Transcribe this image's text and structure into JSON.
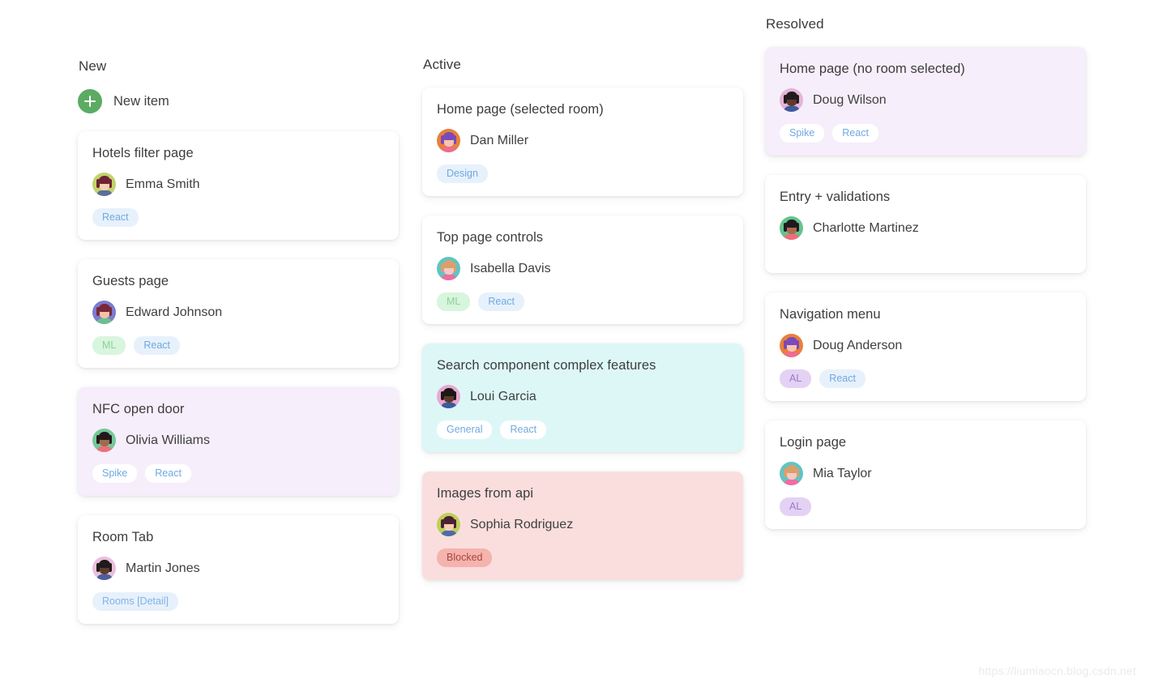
{
  "board": {
    "watermark": "https://liumiaocn.blog.csdn.net",
    "columns": [
      {
        "id": "new",
        "title": "New",
        "new_item_label": "New item",
        "cards": [
          {
            "title": "Hotels filter page",
            "assignee": "Emma Smith",
            "avatar": {
              "bg": "#c3d26a",
              "hair": "#6e2233",
              "skin": "#f7cfb4",
              "body": "#5b6f9c"
            },
            "tags": [
              {
                "label": "React",
                "style": "tag-react"
              }
            ]
          },
          {
            "title": "Guests page",
            "assignee": "Edward Johnson",
            "avatar": {
              "bg": "#7b7ccc",
              "hair": "#7a2738",
              "skin": "#f0c3a4",
              "body": "#6dbf8f"
            },
            "tags": [
              {
                "label": "ML",
                "style": "tag-ml"
              },
              {
                "label": "React",
                "style": "tag-react"
              }
            ]
          },
          {
            "title": "NFC open door",
            "assignee": "Olivia Williams",
            "card_style": "purple",
            "avatar": {
              "bg": "#74c99a",
              "hair": "#23191c",
              "skin": "#a3694c",
              "body": "#ef6d7b"
            },
            "tags": [
              {
                "label": "Spike",
                "style": "tag-white"
              },
              {
                "label": "React",
                "style": "tag-white"
              }
            ]
          },
          {
            "title": "Room Tab",
            "assignee": "Martin Jones",
            "avatar": {
              "bg": "#e8bfdd",
              "hair": "#201a1c",
              "skin": "#5f3b2b",
              "body": "#4c5f9c"
            },
            "tags": [
              {
                "label": "Rooms [Detail]",
                "style": "tag-rooms"
              }
            ]
          }
        ]
      },
      {
        "id": "active",
        "title": "Active",
        "cards": [
          {
            "title": "Home page (selected room)",
            "assignee": "Dan Miller",
            "avatar": {
              "bg": "#e8803a",
              "hair": "#7b4ab8",
              "skin": "#f7c5b0",
              "body": "#ef6d8b"
            },
            "tags": [
              {
                "label": "Design",
                "style": "tag-design"
              }
            ]
          },
          {
            "title": "Top page controls",
            "assignee": "Isabella Davis",
            "avatar": {
              "bg": "#5fc4c4",
              "hair": "#d9a06b",
              "skin": "#f8c8c4",
              "body": "#f06ca0"
            },
            "tags": [
              {
                "label": "ML",
                "style": "tag-ml"
              },
              {
                "label": "React",
                "style": "tag-react"
              }
            ]
          },
          {
            "title": "Search component complex features",
            "assignee": "Loui Garcia",
            "card_style": "cyan",
            "avatar": {
              "bg": "#e9a8d1",
              "hair": "#1d1618",
              "skin": "#5d3a2a",
              "body": "#3d5a9c"
            },
            "tags": [
              {
                "label": "General",
                "style": "tag-white"
              },
              {
                "label": "React",
                "style": "tag-white"
              }
            ]
          },
          {
            "title": "Images from api",
            "assignee": "Sophia Rodriguez",
            "card_style": "pink",
            "avatar": {
              "bg": "#bdd158",
              "hair": "#4a2230",
              "skin": "#f7cdb6",
              "body": "#4e6ba8"
            },
            "tags": [
              {
                "label": "Blocked",
                "style": "tag-blocked"
              }
            ]
          }
        ]
      },
      {
        "id": "resolved",
        "title": "Resolved",
        "cards": [
          {
            "title": "Home page (no room selected)",
            "assignee": "Doug Wilson",
            "card_style": "purple",
            "avatar": {
              "bg": "#e2b5d8",
              "hair": "#231a1d",
              "skin": "#5e3a2a",
              "body": "#3d5a9c"
            },
            "tags": [
              {
                "label": "Spike",
                "style": "tag-white"
              },
              {
                "label": "React",
                "style": "tag-white"
              }
            ]
          },
          {
            "title": "Entry + validations",
            "assignee": "Charlotte Martinez",
            "avatar": {
              "bg": "#63c48c",
              "hair": "#1f1a1d",
              "skin": "#a86b4d",
              "body": "#ef6d7b"
            },
            "tags": []
          },
          {
            "title": "Navigation menu",
            "assignee": "Doug Anderson",
            "avatar": {
              "bg": "#e8803a",
              "hair": "#7b4ab8",
              "skin": "#f7c5b0",
              "body": "#ef6d8b"
            },
            "tags": [
              {
                "label": "AL",
                "style": "tag-al"
              },
              {
                "label": "React",
                "style": "tag-react"
              }
            ]
          },
          {
            "title": "Login page",
            "assignee": "Mia Taylor",
            "avatar": {
              "bg": "#5fc4c4",
              "hair": "#d9a06b",
              "skin": "#f8c8c4",
              "body": "#f06ca0"
            },
            "tags": [
              {
                "label": "AL",
                "style": "tag-al"
              }
            ]
          }
        ]
      }
    ]
  }
}
